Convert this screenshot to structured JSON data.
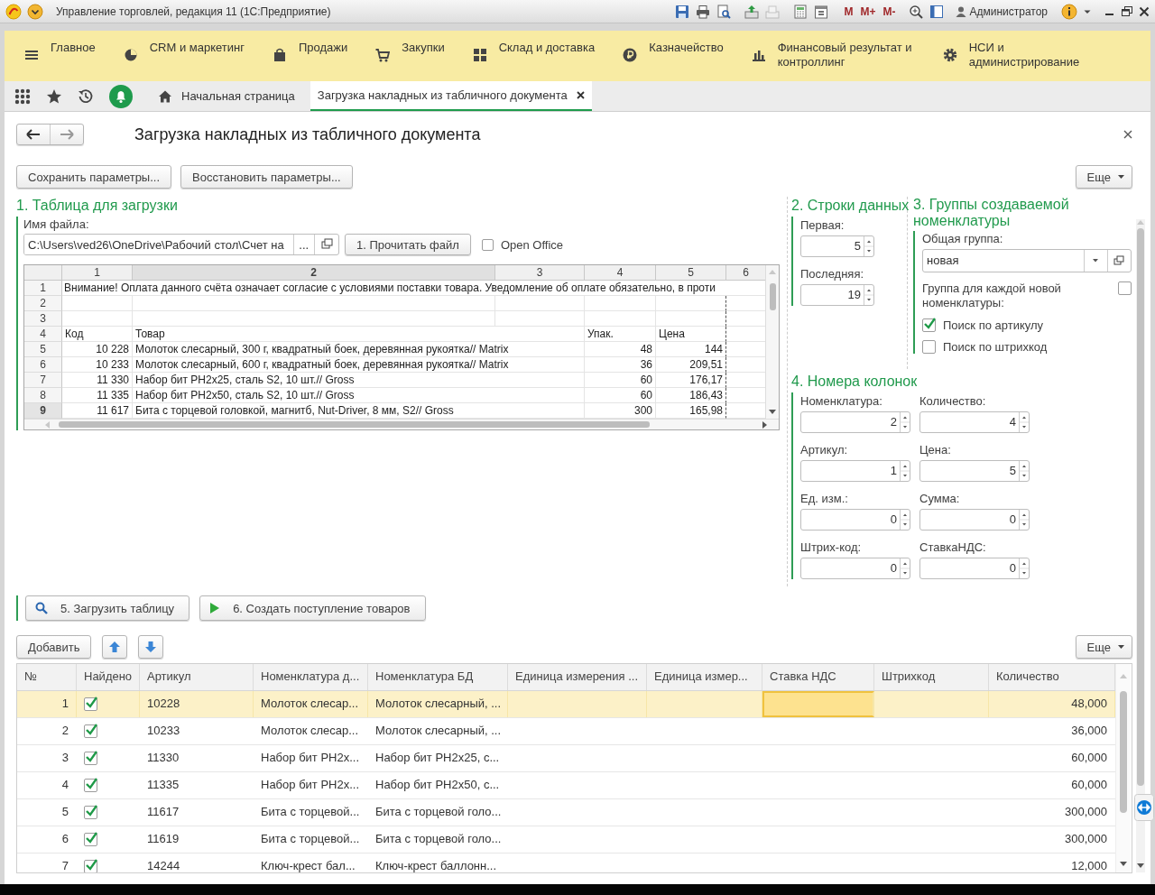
{
  "window": {
    "title": "Управление торговлей, редакция 11  (1С:Предприятие)",
    "memory_buttons": [
      "M",
      "M+",
      "M-"
    ],
    "user": "Администратор"
  },
  "sections": [
    {
      "label": "Главное"
    },
    {
      "label": "CRM и маркетинг"
    },
    {
      "label": "Продажи"
    },
    {
      "label": "Закупки"
    },
    {
      "label": "Склад и доставка"
    },
    {
      "label": "Казначейство"
    },
    {
      "label": "Финансовый результат и контроллинг"
    },
    {
      "label": "НСИ и администрирование"
    }
  ],
  "tabs": [
    {
      "label": "Начальная страница",
      "selected": false,
      "closable": false
    },
    {
      "label": "Загрузка накладных из табличного документа",
      "selected": true,
      "closable": true
    }
  ],
  "form": {
    "title": "Загрузка накладных из табличного документа",
    "buttons": [
      "Сохранить параметры...",
      "Восстановить параметры..."
    ],
    "more_button": "Еще"
  },
  "source": {
    "heading": "1. Таблица для загрузки",
    "file_label": "Имя файла:",
    "file_path": "C:\\Users\\ved26\\OneDrive\\Рабочий стол\\Счет на",
    "select_button": "...",
    "read_button": "1. Прочитать файл",
    "open_office": {
      "label": "Open Office",
      "checked": false
    }
  },
  "sheet": {
    "columns": [
      {
        "label": "1",
        "selected": false
      },
      {
        "label": "2",
        "selected": true
      },
      {
        "label": "3",
        "selected": false
      },
      {
        "label": "4",
        "selected": false
      },
      {
        "label": "5",
        "selected": false
      },
      {
        "label": "6",
        "selected": false
      }
    ],
    "rows": [
      {
        "num": "1",
        "kind": "note",
        "text": "Внимание! Оплата данного счёта означает согласие с условиями поставки товара. Уведомление об оплате обязательно, в проти",
        "selected": false
      },
      {
        "num": "2",
        "kind": "empty",
        "selected": false
      },
      {
        "num": "3",
        "kind": "empty",
        "selected": false
      },
      {
        "num": "4",
        "kind": "header",
        "code": "Код",
        "item": "Товар",
        "pack": "Упак.",
        "price": "Цена",
        "selected": false
      },
      {
        "num": "5",
        "kind": "data",
        "code": "10 228",
        "item": "Молоток слесарный, 300 г, квадратный боек, деревянная рукоятка// Matrix",
        "pack": "48",
        "price": "144",
        "selected": false
      },
      {
        "num": "6",
        "kind": "data",
        "code": "10 233",
        "item": "Молоток слесарный, 600 г, квадратный боек, деревянная рукоятка// Matrix",
        "pack": "36",
        "price": "209,51",
        "selected": false
      },
      {
        "num": "7",
        "kind": "data",
        "code": "11 330",
        "item": "Набор бит PH2x25, сталь S2, 10 шт.// Gross",
        "pack": "60",
        "price": "176,17",
        "selected": false
      },
      {
        "num": "8",
        "kind": "data",
        "code": "11 335",
        "item": "Набор бит PH2x50, сталь S2, 10 шт.// Gross",
        "pack": "60",
        "price": "186,43",
        "selected": false
      },
      {
        "num": "9",
        "kind": "data",
        "code": "11 617",
        "item": "Бита с торцевой головкой, магнитб, Nut-Driver, 8 мм, S2// Gross",
        "pack": "300",
        "price": "165,98",
        "selected": true
      }
    ]
  },
  "rows_range": {
    "heading": "2. Строки данных",
    "fields": [
      {
        "label": "Первая:",
        "value": "5"
      },
      {
        "label": "Последняя:",
        "value": "19"
      }
    ]
  },
  "groups": {
    "heading": "3. Группы создаваемой номенклатуры",
    "common_group": {
      "label": "Общая группа:",
      "value": "новая"
    },
    "options": [
      {
        "label": "Группа для каждой новой номенклатуры:",
        "checked": false,
        "kind": "trailing"
      },
      {
        "label": "Поиск по артикулу",
        "checked": true,
        "kind": "leading"
      },
      {
        "label": "Поиск по штрихкод",
        "checked": false,
        "kind": "leading"
      }
    ]
  },
  "columns_map": {
    "heading": "4. Номера колонок",
    "fields": [
      {
        "label": "Номенклатура:",
        "value": "2"
      },
      {
        "label": "Количество:",
        "value": "4"
      },
      {
        "label": "Артикул:",
        "value": "1"
      },
      {
        "label": "Цена:",
        "value": "5"
      },
      {
        "label": "Ед. изм.:",
        "value": "0"
      },
      {
        "label": "Сумма:",
        "value": "0"
      },
      {
        "label": "Штрих-код:",
        "value": "0"
      },
      {
        "label": "СтавкаНДС:",
        "value": "0"
      }
    ]
  },
  "actions": [
    {
      "label": "5. Загрузить таблицу"
    },
    {
      "label": "6. Создать поступление товаров"
    }
  ],
  "table_toolbar": {
    "add": "Добавить",
    "more": "Еще"
  },
  "table": {
    "columns": [
      "№",
      "Найдено",
      "Артикул",
      "Номенклатура д...",
      "Номенклатура БД",
      "Единица измерения ...",
      "Единица измер...",
      "Ставка НДС",
      "Штрихкод",
      "Количество"
    ],
    "rows": [
      {
        "num": "1",
        "found": true,
        "article": "10228",
        "nom_file": "Молоток слесар...",
        "nom_db": "Молоток слесарный, ...",
        "vat_cell_current": true,
        "qty": "48,000",
        "selected": true
      },
      {
        "num": "2",
        "found": true,
        "article": "10233",
        "nom_file": "Молоток слесар...",
        "nom_db": "Молоток слесарный, ...",
        "vat_cell_current": false,
        "qty": "36,000",
        "selected": false
      },
      {
        "num": "3",
        "found": true,
        "article": "11330",
        "nom_file": "Набор бит PH2x...",
        "nom_db": "Набор бит PH2x25, с...",
        "vat_cell_current": false,
        "qty": "60,000",
        "selected": false
      },
      {
        "num": "4",
        "found": true,
        "article": "11335",
        "nom_file": "Набор бит PH2x...",
        "nom_db": "Набор бит PH2x50, с...",
        "vat_cell_current": false,
        "qty": "60,000",
        "selected": false
      },
      {
        "num": "5",
        "found": true,
        "article": "11617",
        "nom_file": "Бита с торцевой...",
        "nom_db": "Бита с торцевой голо...",
        "vat_cell_current": false,
        "qty": "300,000",
        "selected": false
      },
      {
        "num": "6",
        "found": true,
        "article": "11619",
        "nom_file": "Бита с торцевой...",
        "nom_db": "Бита с торцевой голо...",
        "vat_cell_current": false,
        "qty": "300,000",
        "selected": false
      },
      {
        "num": "7",
        "found": true,
        "article": "14244",
        "nom_file": "Ключ-крест бал...",
        "nom_db": "Ключ-крест баллонн...",
        "vat_cell_current": false,
        "qty": "12,000",
        "selected": false
      }
    ]
  }
}
